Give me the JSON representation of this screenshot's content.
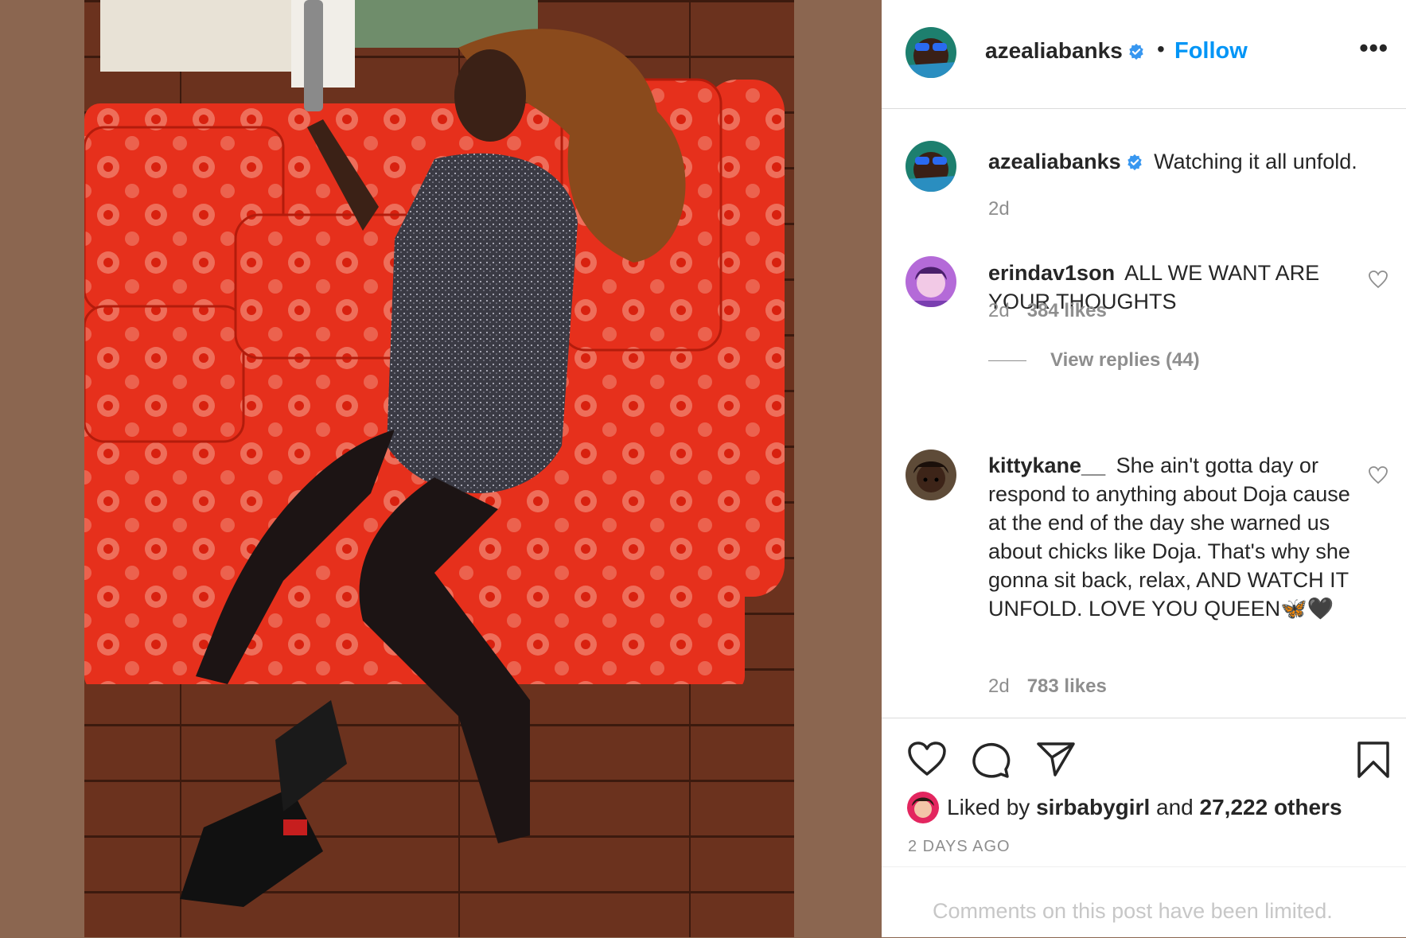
{
  "post": {
    "author": "azealiabanks",
    "follow_label": "Follow",
    "separator": "•",
    "more_label": "•••",
    "caption": "Watching it all unfold.",
    "caption_time": "2d",
    "liked_by_prefix": "Liked by",
    "liked_by_user": "sirbabygirl",
    "liked_by_and": "and",
    "liked_by_others": "27,222 others",
    "posted_ago": "2 DAYS AGO",
    "comments_limited": "Comments on this post have been limited."
  },
  "comments": [
    {
      "user": "erindav1son",
      "text": "ALL WE WANT ARE YOUR THOUGHTS",
      "time": "2d",
      "likes": "384 likes",
      "view_replies": "View replies (44)"
    },
    {
      "user": "kittykane__",
      "text": "She ain't gotta day or respond to anything about Doja cause at the end of the day she warned us about chicks like Doja. That's why she gonna sit back, relax, AND WATCH IT UNFOLD. LOVE YOU QUEEN🦋🖤",
      "time": "2d",
      "likes": "783 likes"
    }
  ],
  "icons": {
    "verified": "verified-badge-icon",
    "like": "heart-icon",
    "comment": "comment-icon",
    "share": "paper-plane-icon",
    "save": "bookmark-icon"
  },
  "colors": {
    "link_blue": "#0095f6",
    "verified_blue": "#3897f0",
    "muted_text": "#8e8e8e",
    "divider": "#dbdbdb",
    "side_background": "#8b6650"
  }
}
